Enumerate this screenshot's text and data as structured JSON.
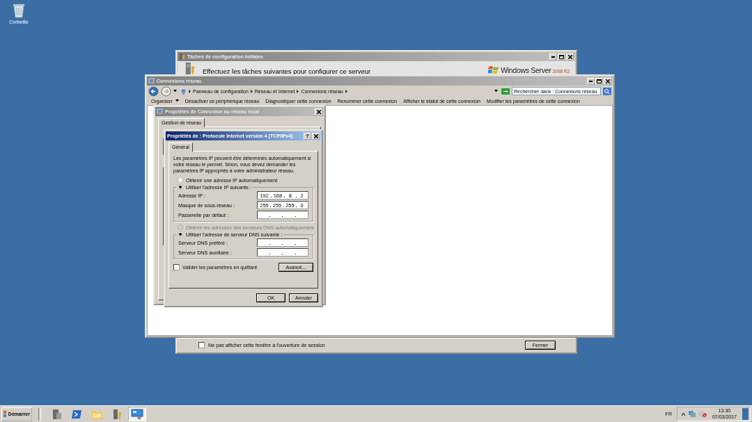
{
  "desktop": {
    "icons": [
      {
        "label": "Corbeille"
      }
    ]
  },
  "server_tasks_window": {
    "title": "Tâches de configuration initiales",
    "heading": "Effectuez les tâches suivantes pour configurer ce serveur",
    "logo": {
      "name": "Windows Server",
      "version": "2008 R2"
    },
    "startup_checkbox": {
      "label": "Ne pas afficher cette fenêtre à l'ouverture de session",
      "checked": false
    },
    "close_button": "Fermer"
  },
  "network_window": {
    "title": "Connexions réseau",
    "breadcrumb": [
      "Panneau de configuration",
      "Réseau et Internet",
      "Connexions réseau"
    ],
    "search": {
      "placeholder": "Rechercher dans : Connexions réseau"
    },
    "toolbar": [
      {
        "label": "Organiser",
        "menu": true
      },
      {
        "label": "Désactiver ce périphérique réseau",
        "menu": false
      },
      {
        "label": "Diagnostiquer cette connexion",
        "menu": false
      },
      {
        "label": "Renommer cette connexion",
        "menu": false
      },
      {
        "label": "Afficher le statut de cette connexion",
        "menu": false
      },
      {
        "label": "Modifier les paramètres de cette connexion",
        "menu": false
      }
    ]
  },
  "lan_dialog": {
    "title": "Propriétés de Connexion au réseau local",
    "tabs": [
      {
        "label": "Gestion de réseau",
        "selected": true
      }
    ]
  },
  "ipv4_dialog": {
    "title": "Propriétés de : Protocole Internet version 4 (TCP/IPv4)",
    "help_button": "?",
    "tabs": [
      {
        "label": "Général",
        "selected": true
      }
    ],
    "description": "Les paramètres IP peuvent être déterminés automatiquement si votre réseau le permet. Sinon, vous devez demander les paramètres IP appropriés à votre administrateur réseau.",
    "ip_mode": [
      {
        "label": "Obtenir une adresse IP automatiquement",
        "selected": false,
        "disabled": false
      },
      {
        "label": "Utiliser l'adresse IP suivante :",
        "selected": true,
        "disabled": false
      }
    ],
    "ip_fields": [
      {
        "label": "Adresse IP :",
        "octets": [
          "192",
          "168",
          "8",
          "2"
        ]
      },
      {
        "label": "Masque de sous-réseau :",
        "octets": [
          "255",
          "255",
          "255",
          "0"
        ]
      },
      {
        "label": "Passerelle par défaut :"
      }
    ],
    "dns_mode": [
      {
        "label": "Obtenir les adresses des serveurs DNS automatiquement",
        "selected": false,
        "disabled": true
      },
      {
        "label": "Utiliser l'adresse de serveur DNS suivante :",
        "selected": true,
        "disabled": false
      }
    ],
    "dns_fields": [
      {
        "label": "Serveur DNS préféré :"
      },
      {
        "label": "Serveur DNS auxiliaire :"
      }
    ],
    "validate_checkbox": {
      "label": "Valider les paramètres en quittant",
      "checked": false
    },
    "advanced_button": "Avancé...",
    "buttons": [
      "OK",
      "Annuler"
    ]
  },
  "taskbar": {
    "start": "Démarrer",
    "apps": [
      {
        "kind": "server",
        "selected": false
      },
      {
        "kind": "shell",
        "selected": false
      },
      {
        "kind": "folder",
        "selected": false
      },
      {
        "kind": "tools",
        "selected": false
      },
      {
        "kind": "network",
        "selected": true
      }
    ],
    "language": "FR",
    "time": "13:30",
    "date": "07/03/2017"
  }
}
